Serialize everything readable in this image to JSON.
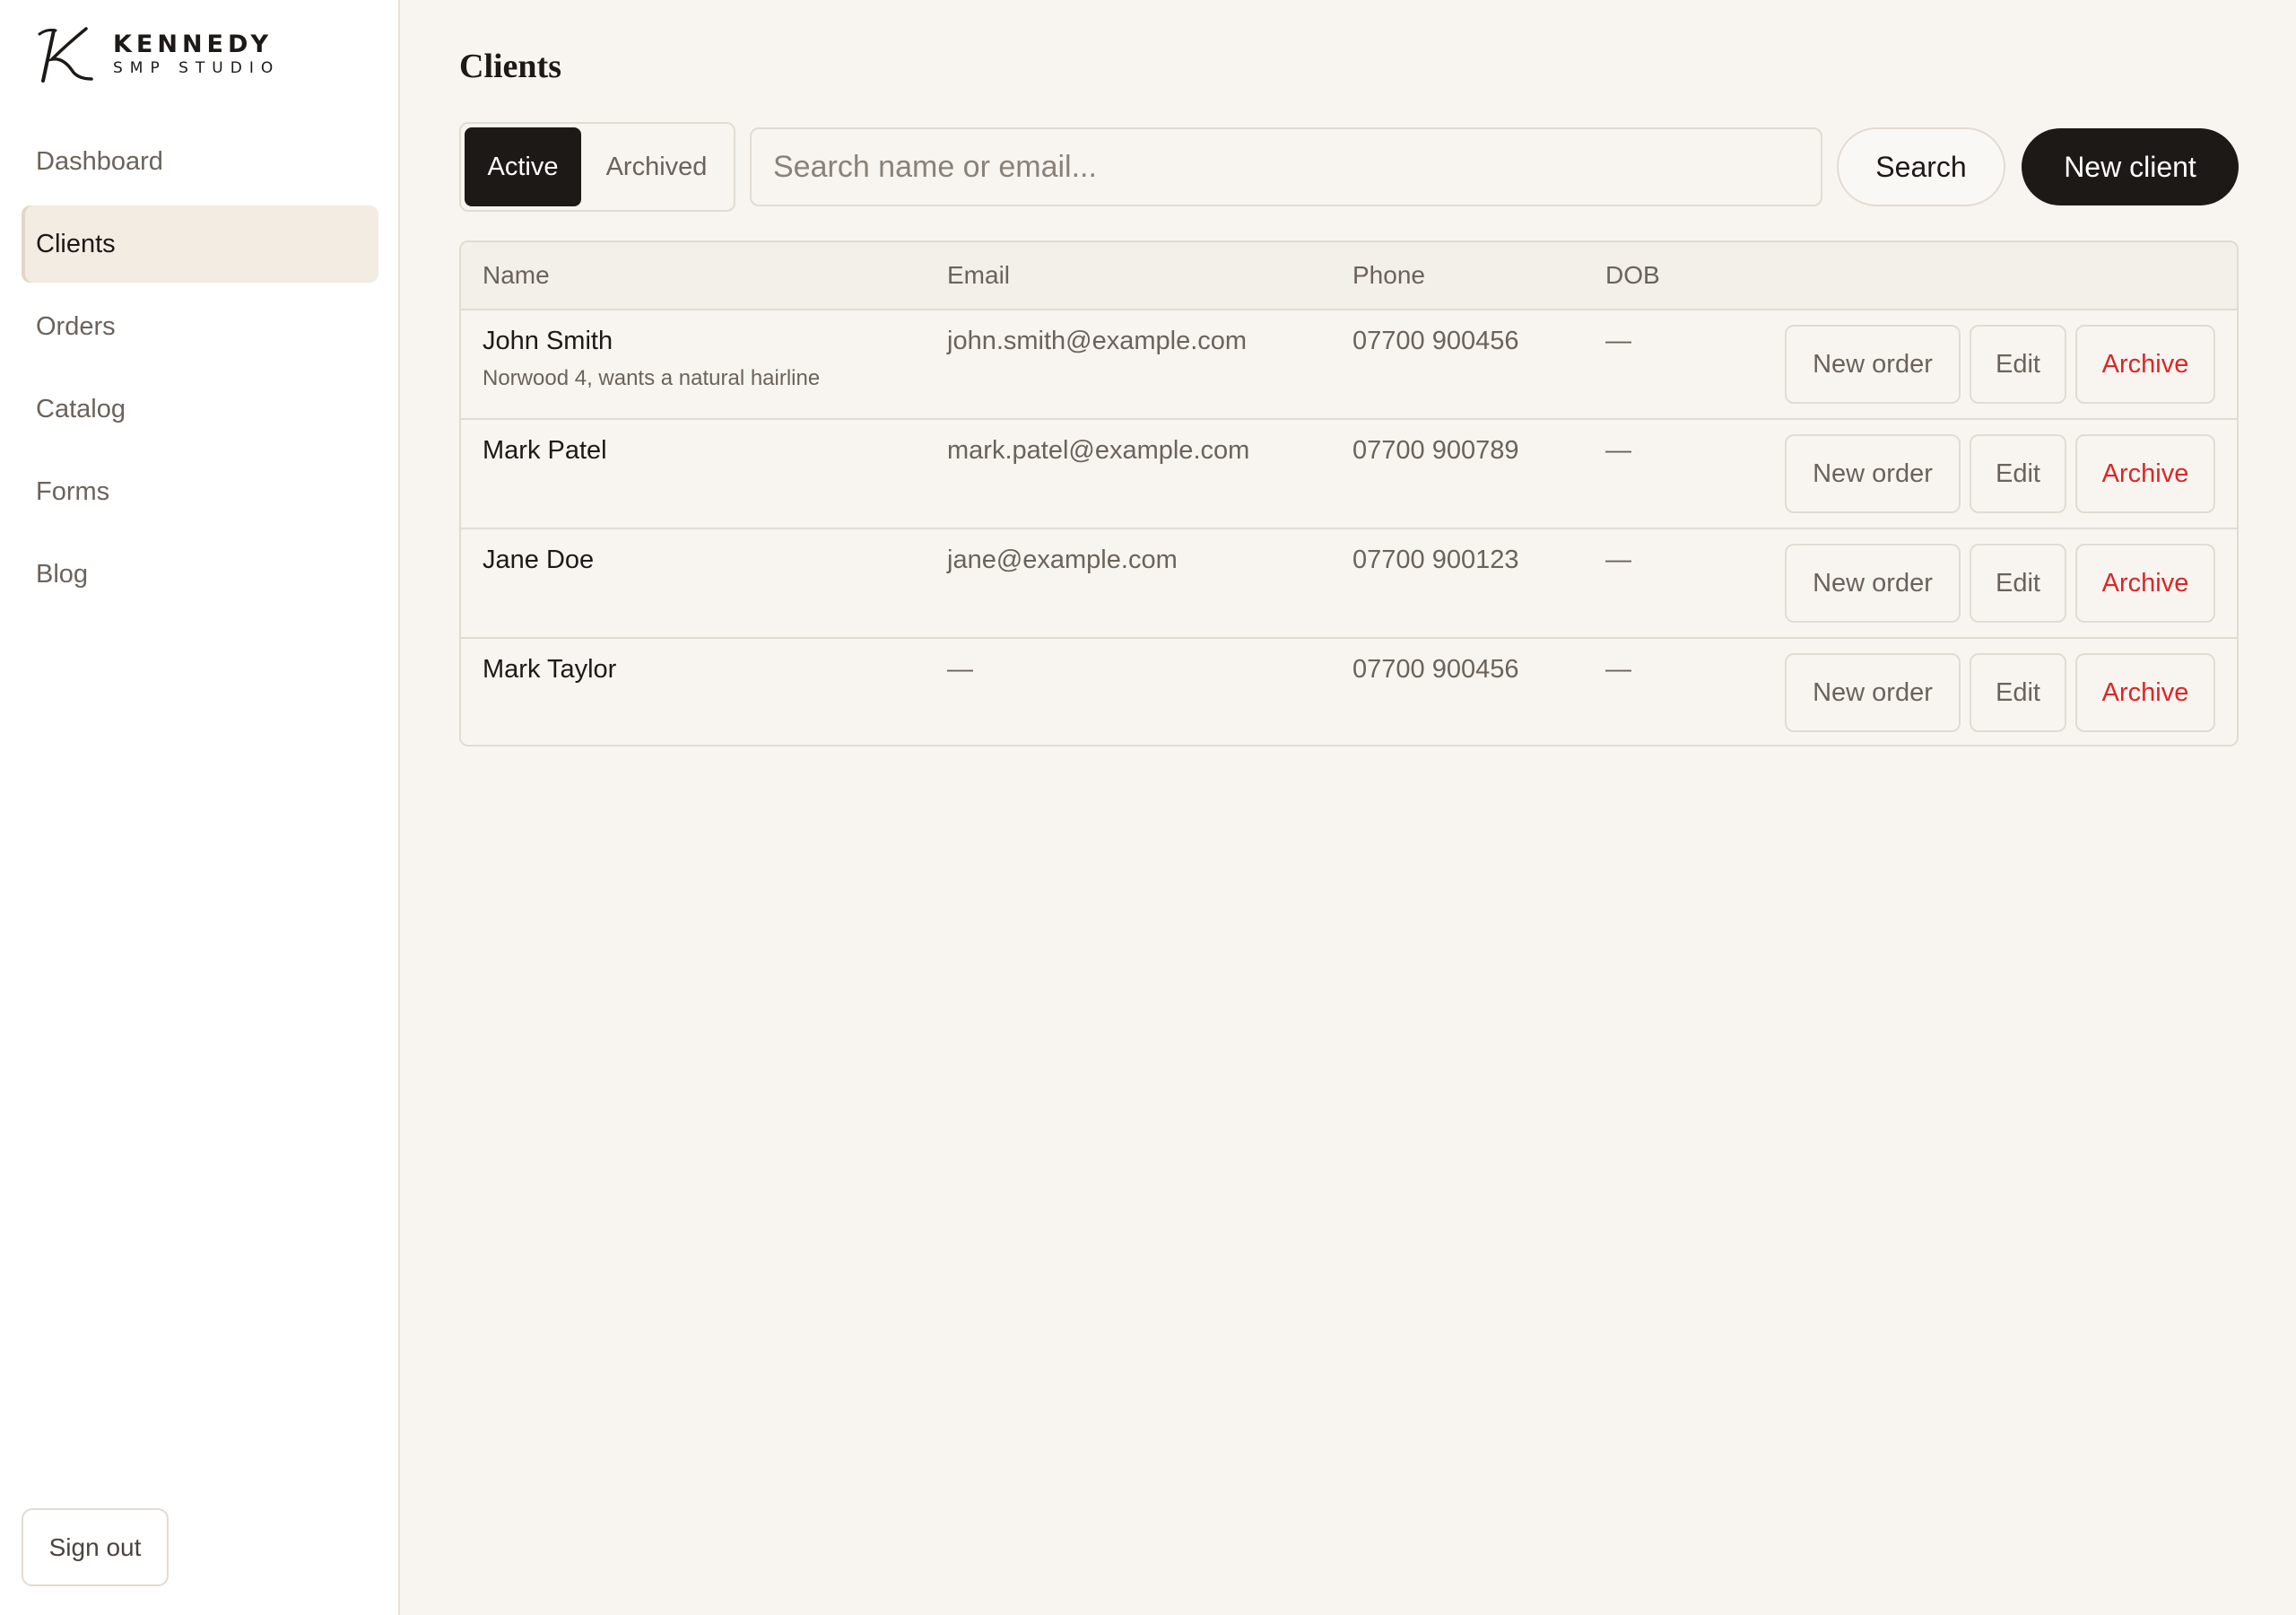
{
  "brand": {
    "line1": "KENNEDY",
    "line2": "SMP STUDIO"
  },
  "sidebar": {
    "items": [
      {
        "label": "Dashboard",
        "active": false
      },
      {
        "label": "Clients",
        "active": true
      },
      {
        "label": "Orders",
        "active": false
      },
      {
        "label": "Catalog",
        "active": false
      },
      {
        "label": "Forms",
        "active": false
      },
      {
        "label": "Blog",
        "active": false
      }
    ],
    "signout_label": "Sign out"
  },
  "main": {
    "title": "Clients",
    "filter": {
      "active_label": "Active",
      "archived_label": "Archived",
      "selected": "Active"
    },
    "search": {
      "placeholder": "Search name or email...",
      "value": "",
      "button_label": "Search"
    },
    "new_client_label": "New client",
    "table": {
      "headers": {
        "name": "Name",
        "email": "Email",
        "phone": "Phone",
        "dob": "DOB"
      },
      "rows": [
        {
          "name": "John Smith",
          "note": "Norwood 4, wants a natural hairline",
          "email": "john.smith@example.com",
          "phone": "07700 900456",
          "dob": "—"
        },
        {
          "name": "Mark Patel",
          "note": "",
          "email": "mark.patel@example.com",
          "phone": "07700 900789",
          "dob": "—"
        },
        {
          "name": "Jane Doe",
          "note": "",
          "email": "jane@example.com",
          "phone": "07700 900123",
          "dob": "—"
        },
        {
          "name": "Mark Taylor",
          "note": "",
          "email": "—",
          "phone": "07700 900456",
          "dob": "—"
        }
      ],
      "actions": {
        "new_order": "New order",
        "edit": "Edit",
        "archive": "Archive"
      }
    }
  },
  "colors": {
    "accent": "#1c1917",
    "danger": "#dc2626",
    "background": "#f8f5f0",
    "active_nav": "#f3ece3"
  }
}
